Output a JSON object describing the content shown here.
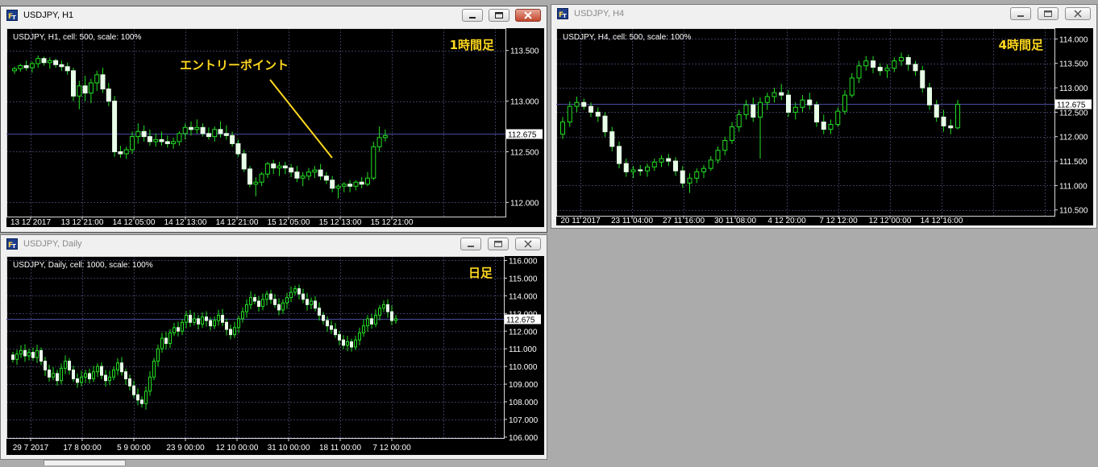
{
  "windows": [
    {
      "id": "h1",
      "title": "USDJPY, H1",
      "active": true,
      "chart_data": {
        "type": "candlestick",
        "symbol": "USDJPY",
        "header": "USDJPY, H1, cell: 500, scale: 100%",
        "corner_label": "1時間足",
        "annotation": "エントリーポイント",
        "current_price": "112.675",
        "current_price_value": 112.675,
        "ylim": [
          111.86,
          113.72
        ],
        "y_ticks": [
          {
            "label": "113.500",
            "value": 113.5
          },
          {
            "label": "113.000",
            "value": 113.0
          },
          {
            "label": "112.500",
            "value": 112.5
          },
          {
            "label": "112.000",
            "value": 112.0
          }
        ],
        "x_labels": [
          "13 12 2017",
          "13 12 21:00",
          "14 12 05:00",
          "14 12 13:00",
          "14 12 21:00",
          "15 12 05:00",
          "15 12 13:00",
          "15 12 21:00"
        ],
        "candles": [
          [
            113.3,
            113.34,
            113.27,
            113.32
          ],
          [
            113.32,
            113.37,
            113.29,
            113.35
          ],
          [
            113.35,
            113.4,
            113.3,
            113.33
          ],
          [
            113.33,
            113.39,
            113.28,
            113.37
          ],
          [
            113.37,
            113.45,
            113.33,
            113.42
          ],
          [
            113.42,
            113.44,
            113.35,
            113.38
          ],
          [
            113.38,
            113.43,
            113.32,
            113.4
          ],
          [
            113.4,
            113.42,
            113.33,
            113.36
          ],
          [
            113.36,
            113.4,
            113.3,
            113.34
          ],
          [
            113.34,
            113.38,
            113.26,
            113.3
          ],
          [
            113.3,
            113.33,
            113.0,
            113.05
          ],
          [
            113.05,
            113.2,
            112.92,
            113.15
          ],
          [
            113.15,
            113.25,
            113.0,
            113.08
          ],
          [
            113.08,
            113.22,
            112.98,
            113.18
          ],
          [
            113.18,
            113.3,
            113.1,
            113.26
          ],
          [
            113.26,
            113.33,
            113.08,
            113.12
          ],
          [
            113.12,
            113.18,
            112.95,
            113.0
          ],
          [
            113.0,
            113.05,
            112.45,
            112.5
          ],
          [
            112.5,
            112.56,
            112.44,
            112.48
          ],
          [
            112.48,
            112.55,
            112.43,
            112.52
          ],
          [
            112.52,
            112.7,
            112.48,
            112.65
          ],
          [
            112.65,
            112.78,
            112.58,
            112.7
          ],
          [
            112.7,
            112.76,
            112.6,
            112.65
          ],
          [
            112.65,
            112.72,
            112.56,
            112.6
          ],
          [
            112.6,
            112.68,
            112.55,
            112.62
          ],
          [
            112.62,
            112.7,
            112.56,
            112.6
          ],
          [
            112.6,
            112.66,
            112.54,
            112.58
          ],
          [
            112.58,
            112.64,
            112.53,
            112.6
          ],
          [
            112.6,
            112.7,
            112.56,
            112.68
          ],
          [
            112.68,
            112.78,
            112.62,
            112.74
          ],
          [
            112.74,
            112.8,
            112.66,
            112.72
          ],
          [
            112.72,
            112.82,
            112.68,
            112.74
          ],
          [
            112.74,
            112.78,
            112.65,
            112.68
          ],
          [
            112.68,
            112.74,
            112.62,
            112.65
          ],
          [
            112.65,
            112.75,
            112.6,
            112.72
          ],
          [
            112.72,
            112.8,
            112.64,
            112.68
          ],
          [
            112.68,
            112.76,
            112.62,
            112.66
          ],
          [
            112.66,
            112.7,
            112.55,
            112.58
          ],
          [
            112.58,
            112.62,
            112.45,
            112.48
          ],
          [
            112.48,
            112.52,
            112.3,
            112.33
          ],
          [
            112.33,
            112.36,
            112.15,
            112.18
          ],
          [
            112.18,
            112.25,
            112.06,
            112.2
          ],
          [
            112.2,
            112.3,
            112.16,
            112.28
          ],
          [
            112.28,
            112.4,
            112.24,
            112.38
          ],
          [
            112.38,
            112.42,
            112.28,
            112.34
          ],
          [
            112.34,
            112.4,
            112.26,
            112.36
          ],
          [
            112.36,
            112.4,
            112.28,
            112.34
          ],
          [
            112.34,
            112.38,
            112.25,
            112.3
          ],
          [
            112.3,
            112.36,
            112.2,
            112.24
          ],
          [
            112.24,
            112.3,
            112.16,
            112.26
          ],
          [
            112.26,
            112.34,
            112.22,
            112.3
          ],
          [
            112.3,
            112.36,
            112.24,
            112.32
          ],
          [
            112.32,
            112.38,
            112.22,
            112.26
          ],
          [
            112.26,
            112.3,
            112.18,
            112.22
          ],
          [
            112.22,
            112.26,
            112.1,
            112.14
          ],
          [
            112.14,
            112.18,
            112.04,
            112.16
          ],
          [
            112.16,
            112.2,
            112.1,
            112.18
          ],
          [
            112.18,
            112.22,
            112.1,
            112.16
          ],
          [
            112.16,
            112.22,
            112.12,
            112.2
          ],
          [
            112.2,
            112.25,
            112.14,
            112.18
          ],
          [
            112.18,
            112.3,
            112.16,
            112.24
          ],
          [
            112.24,
            112.6,
            112.22,
            112.55
          ],
          [
            112.55,
            112.75,
            112.5,
            112.64
          ],
          [
            112.64,
            112.72,
            112.6,
            112.66
          ]
        ]
      }
    },
    {
      "id": "h4",
      "title": "USDJPY, H4",
      "active": false,
      "chart_data": {
        "type": "candlestick",
        "symbol": "USDJPY",
        "header": "USDJPY, H4, cell: 500, scale: 100%",
        "corner_label": "4時間足",
        "current_price": "112.675",
        "current_price_value": 112.675,
        "ylim": [
          110.38,
          114.22
        ],
        "y_ticks": [
          {
            "label": "114.000",
            "value": 114.0
          },
          {
            "label": "113.500",
            "value": 113.5
          },
          {
            "label": "113.000",
            "value": 113.0
          },
          {
            "label": "112.500",
            "value": 112.5
          },
          {
            "label": "112.000",
            "value": 112.0
          },
          {
            "label": "111.500",
            "value": 111.5
          },
          {
            "label": "111.000",
            "value": 111.0
          },
          {
            "label": "110.500",
            "value": 110.5
          }
        ],
        "x_labels": [
          "20 11 2017",
          "23 11 04:00",
          "27 11 16:00",
          "30 11 08:00",
          "4 12 20:00",
          "7 12 12:00",
          "12 12 00:00",
          "14 12 16:00"
        ],
        "candles": [
          [
            112.05,
            112.4,
            111.95,
            112.3
          ],
          [
            112.3,
            112.72,
            112.2,
            112.62
          ],
          [
            112.62,
            112.82,
            112.5,
            112.7
          ],
          [
            112.7,
            112.78,
            112.55,
            112.62
          ],
          [
            112.62,
            112.7,
            112.4,
            112.5
          ],
          [
            112.5,
            112.6,
            112.3,
            112.42
          ],
          [
            112.42,
            112.5,
            112.0,
            112.1
          ],
          [
            112.1,
            112.2,
            111.7,
            111.8
          ],
          [
            111.8,
            111.9,
            111.35,
            111.45
          ],
          [
            111.45,
            111.55,
            111.18,
            111.28
          ],
          [
            111.28,
            111.4,
            111.15,
            111.32
          ],
          [
            111.32,
            111.42,
            111.2,
            111.3
          ],
          [
            111.3,
            111.45,
            111.18,
            111.38
          ],
          [
            111.38,
            111.55,
            111.3,
            111.48
          ],
          [
            111.48,
            111.62,
            111.38,
            111.55
          ],
          [
            111.55,
            111.65,
            111.4,
            111.5
          ],
          [
            111.5,
            111.58,
            111.2,
            111.3
          ],
          [
            111.3,
            111.4,
            110.95,
            111.05
          ],
          [
            111.05,
            111.25,
            110.85,
            111.15
          ],
          [
            111.15,
            111.35,
            111.05,
            111.28
          ],
          [
            111.28,
            111.42,
            111.15,
            111.35
          ],
          [
            111.35,
            111.6,
            111.3,
            111.52
          ],
          [
            111.52,
            111.8,
            111.45,
            111.72
          ],
          [
            111.72,
            112.0,
            111.62,
            111.92
          ],
          [
            111.92,
            112.3,
            111.85,
            112.2
          ],
          [
            112.2,
            112.55,
            112.1,
            112.45
          ],
          [
            112.45,
            112.75,
            112.35,
            112.65
          ],
          [
            112.65,
            112.8,
            112.3,
            112.4
          ],
          [
            112.4,
            112.8,
            111.55,
            112.7
          ],
          [
            112.7,
            112.9,
            112.55,
            112.82
          ],
          [
            112.82,
            113.0,
            112.7,
            112.9
          ],
          [
            112.9,
            113.08,
            112.75,
            112.85
          ],
          [
            112.85,
            112.95,
            112.4,
            112.5
          ],
          [
            112.5,
            112.7,
            112.35,
            112.6
          ],
          [
            112.6,
            112.85,
            112.5,
            112.75
          ],
          [
            112.75,
            112.9,
            112.55,
            112.65
          ],
          [
            112.65,
            112.72,
            112.2,
            112.3
          ],
          [
            112.3,
            112.45,
            112.05,
            112.15
          ],
          [
            112.15,
            112.35,
            112.05,
            112.25
          ],
          [
            112.25,
            112.6,
            112.2,
            112.52
          ],
          [
            112.52,
            112.95,
            112.45,
            112.85
          ],
          [
            112.85,
            113.3,
            112.8,
            113.2
          ],
          [
            113.2,
            113.55,
            113.1,
            113.45
          ],
          [
            113.45,
            113.65,
            113.35,
            113.55
          ],
          [
            113.55,
            113.65,
            113.3,
            113.42
          ],
          [
            113.42,
            113.5,
            113.25,
            113.35
          ],
          [
            113.35,
            113.48,
            113.2,
            113.4
          ],
          [
            113.4,
            113.62,
            113.32,
            113.55
          ],
          [
            113.55,
            113.72,
            113.45,
            113.62
          ],
          [
            113.62,
            113.68,
            113.35,
            113.48
          ],
          [
            113.48,
            113.55,
            113.25,
            113.35
          ],
          [
            113.35,
            113.45,
            112.9,
            113.0
          ],
          [
            113.0,
            113.1,
            112.55,
            112.65
          ],
          [
            112.65,
            112.75,
            112.3,
            112.4
          ],
          [
            112.4,
            112.55,
            112.1,
            112.22
          ],
          [
            112.22,
            112.35,
            112.05,
            112.18
          ],
          [
            112.18,
            112.75,
            112.15,
            112.66
          ]
        ]
      }
    },
    {
      "id": "daily",
      "title": "USDJPY, Daily",
      "active": false,
      "chart_data": {
        "type": "candlestick",
        "symbol": "USDJPY",
        "header": "USDJPY, Daily, cell: 1000, scale: 100%",
        "corner_label": "日足",
        "current_price": "112.675",
        "current_price_value": 112.675,
        "ylim": [
          105.95,
          116.25
        ],
        "y_ticks": [
          {
            "label": "116.000",
            "value": 116.0
          },
          {
            "label": "115.000",
            "value": 115.0
          },
          {
            "label": "114.000",
            "value": 114.0
          },
          {
            "label": "113.000",
            "value": 113.0
          },
          {
            "label": "112.000",
            "value": 112.0
          },
          {
            "label": "111.000",
            "value": 111.0
          },
          {
            "label": "110.000",
            "value": 110.0
          },
          {
            "label": "109.000",
            "value": 109.0
          },
          {
            "label": "108.000",
            "value": 108.0
          },
          {
            "label": "107.000",
            "value": 107.0
          },
          {
            "label": "106.000",
            "value": 106.0
          }
        ],
        "x_labels": [
          "29 7 2017",
          "17 8 00:00",
          "5 9 00:00",
          "23 9 00:00",
          "12 10 00:00",
          "31 10 00:00",
          "18 11 00:00",
          "7 12 00:00"
        ],
        "closes": [
          110.4,
          110.7,
          110.9,
          110.6,
          110.8,
          110.5,
          110.9,
          110.3,
          109.8,
          109.4,
          109.6,
          109.2,
          109.9,
          110.3,
          109.8,
          109.3,
          109.1,
          109.4,
          109.6,
          109.3,
          109.7,
          110.0,
          109.5,
          109.2,
          109.4,
          109.8,
          110.2,
          109.7,
          109.3,
          108.9,
          108.4,
          108.1,
          107.9,
          108.6,
          109.4,
          110.3,
          111.0,
          111.6,
          111.3,
          111.9,
          112.2,
          112.0,
          112.5,
          112.9,
          112.5,
          112.7,
          112.4,
          112.8,
          112.6,
          112.3,
          112.6,
          112.9,
          112.5,
          112.1,
          111.8,
          112.2,
          112.7,
          113.1,
          113.5,
          113.9,
          113.7,
          113.4,
          113.8,
          114.1,
          113.8,
          113.5,
          113.2,
          113.6,
          113.9,
          114.2,
          114.4,
          114.1,
          113.8,
          113.5,
          113.7,
          113.3,
          112.9,
          112.6,
          112.3,
          112.1,
          111.8,
          111.5,
          111.2,
          111.4,
          111.1,
          111.5,
          111.9,
          112.3,
          112.7,
          112.4,
          112.9,
          113.3,
          113.5,
          113.1,
          112.6,
          112.7
        ]
      }
    }
  ]
}
